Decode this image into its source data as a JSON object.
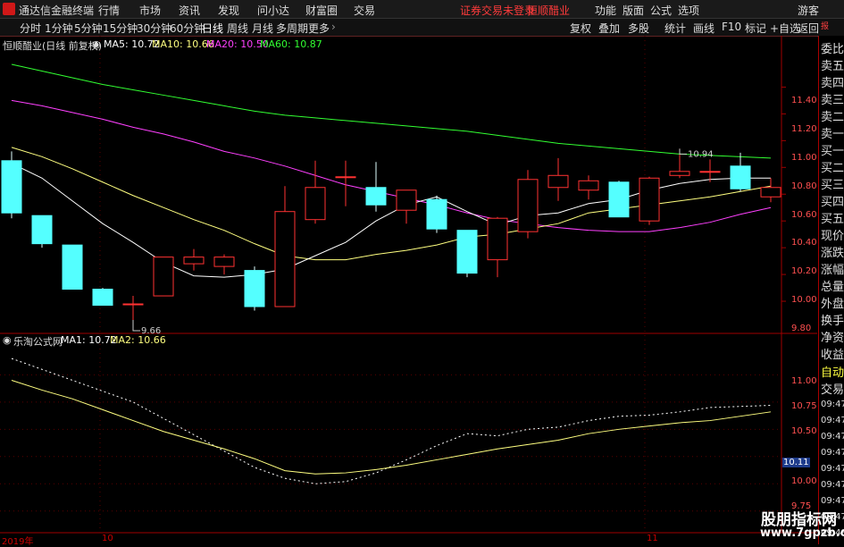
{
  "menubar": {
    "app_title": "通达信金融终端",
    "items": [
      "行情",
      "市场",
      "资讯",
      "发现",
      "问小达",
      "财富圈",
      "交易"
    ],
    "warning": "证券交易未登录",
    "stock_name": "恒顺醋业",
    "right_items": [
      "功能",
      "版面",
      "公式",
      "选项"
    ],
    "guest": "游客"
  },
  "toolbar": {
    "periods": [
      "分时",
      "1分钟",
      "5分钟",
      "15分钟",
      "30分钟",
      "60分钟",
      "日线",
      "周线",
      "月线",
      "多周期",
      "更多"
    ],
    "active_period": "日线",
    "right_items": [
      "复权",
      "叠加",
      "多股",
      "统计",
      "画线",
      "F10",
      "标记",
      "+自选",
      "返回"
    ]
  },
  "main_chart": {
    "legend_title": "恒顺醋业(日线 前复权)",
    "ma5": "MA5: 10.72",
    "ma10": "MA10: 10.66",
    "ma20": "MA20: 10.50",
    "ma60": "MA60: 10.87",
    "high_mark": "10.94",
    "low_mark": "9.66",
    "yticks": [
      "11.40",
      "11.20",
      "11.00",
      "10.80",
      "10.60",
      "10.40",
      "10.20",
      "10.00",
      "9.80"
    ]
  },
  "sub_chart": {
    "legend_title": "乐淘公式网",
    "ma1": "MA1: 10.72",
    "ma2": "MA2: 10.66",
    "yticks": [
      "11.00",
      "10.75",
      "10.50",
      "10.25",
      "10.00",
      "9.75"
    ],
    "current_value": "10.11"
  },
  "right_panel": {
    "labels": [
      "委比",
      "卖五",
      "卖四",
      "卖三",
      "卖二",
      "卖一",
      "买一",
      "买二",
      "买三",
      "买四",
      "买五",
      "现价",
      "涨跌",
      "涨幅",
      "总量",
      "外盘",
      "换手",
      "净资",
      "收益"
    ],
    "auto_label": "自动",
    "trade_label": "交易",
    "times": [
      "09:47",
      "09:47",
      "09:47",
      "09:47",
      "09:47",
      "09:47",
      "09:47",
      "09:47",
      "09:48"
    ]
  },
  "xaxis": {
    "labels": [
      "2019年",
      "10",
      "11"
    ]
  },
  "watermark": {
    "line1": "股朋指标网",
    "line2": "www.7gpzb.com"
  },
  "colors": {
    "up": "#ff3232",
    "down": "#54ffff",
    "ma5": "#ffffff",
    "ma10": "#ffff80",
    "ma20": "#ff40ff",
    "ma60": "#32ff32",
    "grid": "#8b0000"
  },
  "chart_data": {
    "type": "candlestick",
    "candles": [
      {
        "o": 10.85,
        "c": 10.46,
        "h": 10.92,
        "l": 10.42
      },
      {
        "o": 10.44,
        "c": 10.23,
        "h": 10.44,
        "l": 10.2
      },
      {
        "o": 10.22,
        "c": 9.89,
        "h": 10.22,
        "l": 9.89
      },
      {
        "o": 9.89,
        "c": 9.77,
        "h": 9.9,
        "l": 9.77
      },
      {
        "o": 9.78,
        "c": 9.78,
        "h": 9.84,
        "l": 9.66
      },
      {
        "o": 9.84,
        "c": 10.13,
        "h": 10.13,
        "l": 9.84
      },
      {
        "o": 10.08,
        "c": 10.13,
        "h": 10.19,
        "l": 10.03
      },
      {
        "o": 10.06,
        "c": 10.13,
        "h": 10.15,
        "l": 10.0
      },
      {
        "o": 10.03,
        "c": 9.76,
        "h": 10.06,
        "l": 9.73
      },
      {
        "o": 9.76,
        "c": 10.47,
        "h": 10.66,
        "l": 9.76
      },
      {
        "o": 10.41,
        "c": 10.65,
        "h": 10.85,
        "l": 10.38
      },
      {
        "o": 10.73,
        "c": 10.73,
        "h": 10.85,
        "l": 10.51
      },
      {
        "o": 10.65,
        "c": 10.52,
        "h": 10.84,
        "l": 10.47
      },
      {
        "o": 10.48,
        "c": 10.63,
        "h": 10.63,
        "l": 10.38
      },
      {
        "o": 10.56,
        "c": 10.34,
        "h": 10.59,
        "l": 10.31
      },
      {
        "o": 10.33,
        "c": 10.01,
        "h": 10.33,
        "l": 9.98
      },
      {
        "o": 10.11,
        "c": 10.42,
        "h": 10.43,
        "l": 9.98
      },
      {
        "o": 10.32,
        "c": 10.71,
        "h": 10.78,
        "l": 10.27
      },
      {
        "o": 10.65,
        "c": 10.74,
        "h": 10.87,
        "l": 10.55
      },
      {
        "o": 10.63,
        "c": 10.7,
        "h": 10.74,
        "l": 10.56
      },
      {
        "o": 10.69,
        "c": 10.43,
        "h": 10.7,
        "l": 10.43
      },
      {
        "o": 10.4,
        "c": 10.72,
        "h": 10.73,
        "l": 10.37
      },
      {
        "o": 10.74,
        "c": 10.77,
        "h": 10.94,
        "l": 10.72
      },
      {
        "o": 10.77,
        "c": 10.77,
        "h": 10.86,
        "l": 10.69
      },
      {
        "o": 10.81,
        "c": 10.64,
        "h": 10.91,
        "l": 10.62
      },
      {
        "o": 10.58,
        "c": 10.65,
        "h": 10.72,
        "l": 10.54
      }
    ],
    "ma5": [
      10.83,
      10.72,
      10.55,
      10.38,
      10.24,
      10.09,
      9.99,
      9.98,
      10.0,
      10.04,
      10.14,
      10.24,
      10.4,
      10.52,
      10.58,
      10.47,
      10.37,
      10.44,
      10.46,
      10.53,
      10.56,
      10.63,
      10.68,
      10.71,
      10.72,
      10.72
    ],
    "ma10": [
      10.95,
      10.88,
      10.79,
      10.69,
      10.59,
      10.5,
      10.41,
      10.33,
      10.23,
      10.14,
      10.11,
      10.11,
      10.15,
      10.18,
      10.22,
      10.28,
      10.3,
      10.34,
      10.38,
      10.46,
      10.49,
      10.52,
      10.55,
      10.58,
      10.62,
      10.66
    ],
    "ma20": [
      11.3,
      11.26,
      11.21,
      11.16,
      11.1,
      11.05,
      10.99,
      10.92,
      10.87,
      10.81,
      10.74,
      10.67,
      10.62,
      10.57,
      10.52,
      10.46,
      10.41,
      10.38,
      10.35,
      10.33,
      10.32,
      10.32,
      10.35,
      10.39,
      10.45,
      10.5
    ],
    "ma60": [
      11.57,
      11.52,
      11.47,
      11.42,
      11.38,
      11.34,
      11.3,
      11.26,
      11.22,
      11.19,
      11.17,
      11.15,
      11.13,
      11.11,
      11.09,
      11.07,
      11.04,
      11.01,
      10.98,
      10.96,
      10.94,
      10.92,
      10.9,
      10.89,
      10.88,
      10.87
    ],
    "ylim": [
      9.66,
      11.57
    ],
    "sub_ma1": [
      11.15,
      11.05,
      10.95,
      10.85,
      10.75,
      10.6,
      10.45,
      10.3,
      10.15,
      10.05,
      10.0,
      10.02,
      10.1,
      10.22,
      10.35,
      10.46,
      10.44,
      10.5,
      10.52,
      10.58,
      10.62,
      10.63,
      10.66,
      10.7,
      10.71,
      10.72
    ],
    "sub_ma2": [
      10.95,
      10.86,
      10.78,
      10.68,
      10.58,
      10.48,
      10.4,
      10.32,
      10.23,
      10.12,
      10.09,
      10.1,
      10.13,
      10.17,
      10.22,
      10.27,
      10.32,
      10.36,
      10.4,
      10.46,
      10.5,
      10.53,
      10.56,
      10.58,
      10.62,
      10.66
    ],
    "sub_ylim": [
      9.6,
      11.2
    ]
  }
}
